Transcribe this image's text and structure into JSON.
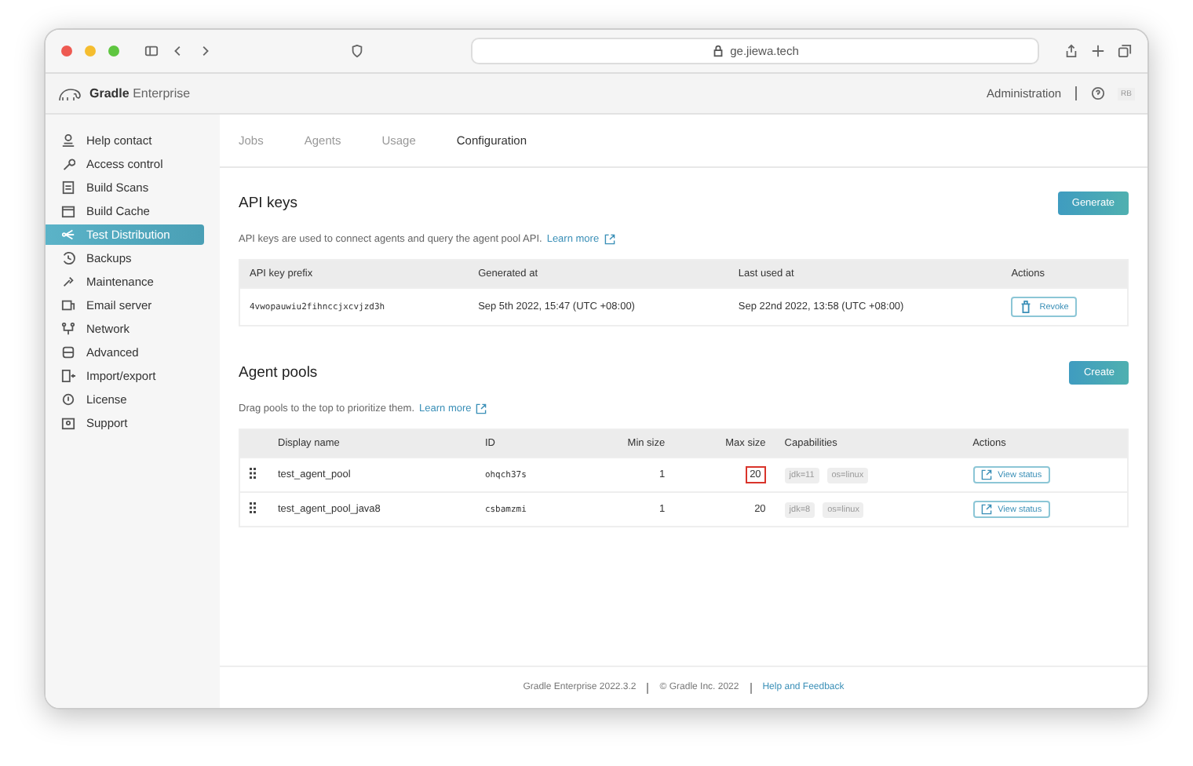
{
  "browser": {
    "url": "ge.jiewa.tech"
  },
  "header": {
    "brand_bold": "Gradle",
    "brand_light": "Enterprise",
    "admin_link": "Administration",
    "avatar": "RB"
  },
  "sidebar": {
    "items": [
      {
        "label": "Help contact",
        "selected": false
      },
      {
        "label": "Access control",
        "selected": false
      },
      {
        "label": "Build Scans",
        "selected": false
      },
      {
        "label": "Build Cache",
        "selected": false
      },
      {
        "label": "Test Distribution",
        "selected": true
      },
      {
        "label": "Backups",
        "selected": false
      },
      {
        "label": "Maintenance",
        "selected": false
      },
      {
        "label": "Email server",
        "selected": false
      },
      {
        "label": "Network",
        "selected": false
      },
      {
        "label": "Advanced",
        "selected": false
      },
      {
        "label": "Import/export",
        "selected": false
      },
      {
        "label": "License",
        "selected": false
      },
      {
        "label": "Support",
        "selected": false
      }
    ]
  },
  "tabs": [
    {
      "label": "Jobs",
      "selected": false
    },
    {
      "label": "Agents",
      "selected": false
    },
    {
      "label": "Usage",
      "selected": false
    },
    {
      "label": "Configuration",
      "selected": true
    }
  ],
  "api_keys": {
    "title": "API keys",
    "button": "Generate",
    "description": "API keys are used to connect agents and query the agent pool API.",
    "learn_more": "Learn more",
    "columns": [
      "API key prefix",
      "Generated at",
      "Last used at",
      "Actions"
    ],
    "rows": [
      {
        "prefix": "4vwopauwiu2fihnccjxcvjzd3h",
        "generated": "Sep 5th 2022, 15:47 (UTC +08:00)",
        "last_used": "Sep 22nd 2022, 13:58 (UTC +08:00)",
        "action": "Revoke"
      }
    ]
  },
  "agent_pools": {
    "title": "Agent pools",
    "button": "Create",
    "description": "Drag pools to the top to prioritize them.",
    "learn_more": "Learn more",
    "columns": [
      "Display name",
      "ID",
      "Min size",
      "Max size",
      "Capabilities",
      "Actions"
    ],
    "rows": [
      {
        "name": "test_agent_pool",
        "id": "ohqch37s",
        "min": "1",
        "max": "20",
        "max_highlighted": true,
        "capabilities": [
          "jdk=11",
          "os=linux"
        ],
        "action": "View status"
      },
      {
        "name": "test_agent_pool_java8",
        "id": "csbamzmi",
        "min": "1",
        "max": "20",
        "max_highlighted": false,
        "capabilities": [
          "jdk=8",
          "os=linux"
        ],
        "action": "View status"
      }
    ]
  },
  "footer": {
    "version": "Gradle Enterprise 2022.3.2",
    "copyright": "© Gradle Inc. 2022",
    "help": "Help and Feedback"
  }
}
